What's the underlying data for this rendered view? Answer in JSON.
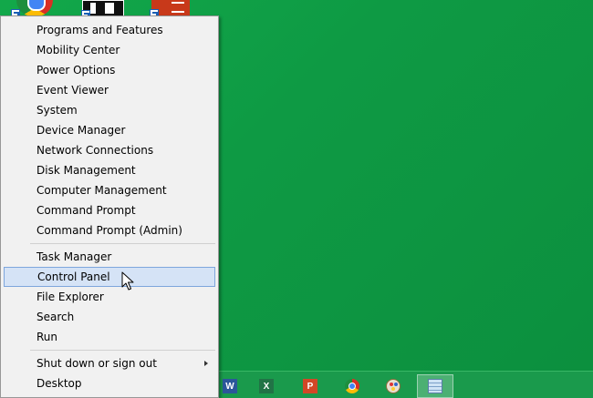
{
  "menu": {
    "group1": [
      {
        "label": "Programs and Features",
        "name": "programs-and-features"
      },
      {
        "label": "Mobility Center",
        "name": "mobility-center"
      },
      {
        "label": "Power Options",
        "name": "power-options"
      },
      {
        "label": "Event Viewer",
        "name": "event-viewer"
      },
      {
        "label": "System",
        "name": "system"
      },
      {
        "label": "Device Manager",
        "name": "device-manager"
      },
      {
        "label": "Network Connections",
        "name": "network-connections"
      },
      {
        "label": "Disk Management",
        "name": "disk-management"
      },
      {
        "label": "Computer Management",
        "name": "computer-management"
      },
      {
        "label": "Command Prompt",
        "name": "command-prompt"
      },
      {
        "label": "Command Prompt (Admin)",
        "name": "command-prompt-admin"
      }
    ],
    "group2": [
      {
        "label": "Task Manager",
        "name": "task-manager"
      },
      {
        "label": "Control Panel",
        "name": "control-panel"
      },
      {
        "label": "File Explorer",
        "name": "file-explorer"
      },
      {
        "label": "Search",
        "name": "search"
      },
      {
        "label": "Run",
        "name": "run"
      }
    ],
    "group3": [
      {
        "label": "Shut down or sign out",
        "name": "shut-down-or-sign-out"
      },
      {
        "label": "Desktop",
        "name": "desktop"
      }
    ],
    "highlighted": "control-panel"
  },
  "desktop_icons": [
    "chrome-icon",
    "app-icon",
    "office-icon"
  ],
  "taskbar": {
    "apps": [
      {
        "name": "word-icon",
        "glyph": "W"
      },
      {
        "name": "excel-icon",
        "glyph": "X"
      },
      {
        "name": "powerpoint-icon",
        "glyph": "P"
      },
      {
        "name": "chrome-icon",
        "glyph": ""
      },
      {
        "name": "paint-icon",
        "glyph": ""
      },
      {
        "name": "notepad-icon",
        "glyph": ""
      }
    ],
    "active_app": "notepad-icon"
  },
  "colors": {
    "desktop_bg": "#0e9a44",
    "menu_bg": "#f1f1f1",
    "highlight_bg": "#d5e3f6",
    "highlight_border": "#7ea6dc"
  }
}
